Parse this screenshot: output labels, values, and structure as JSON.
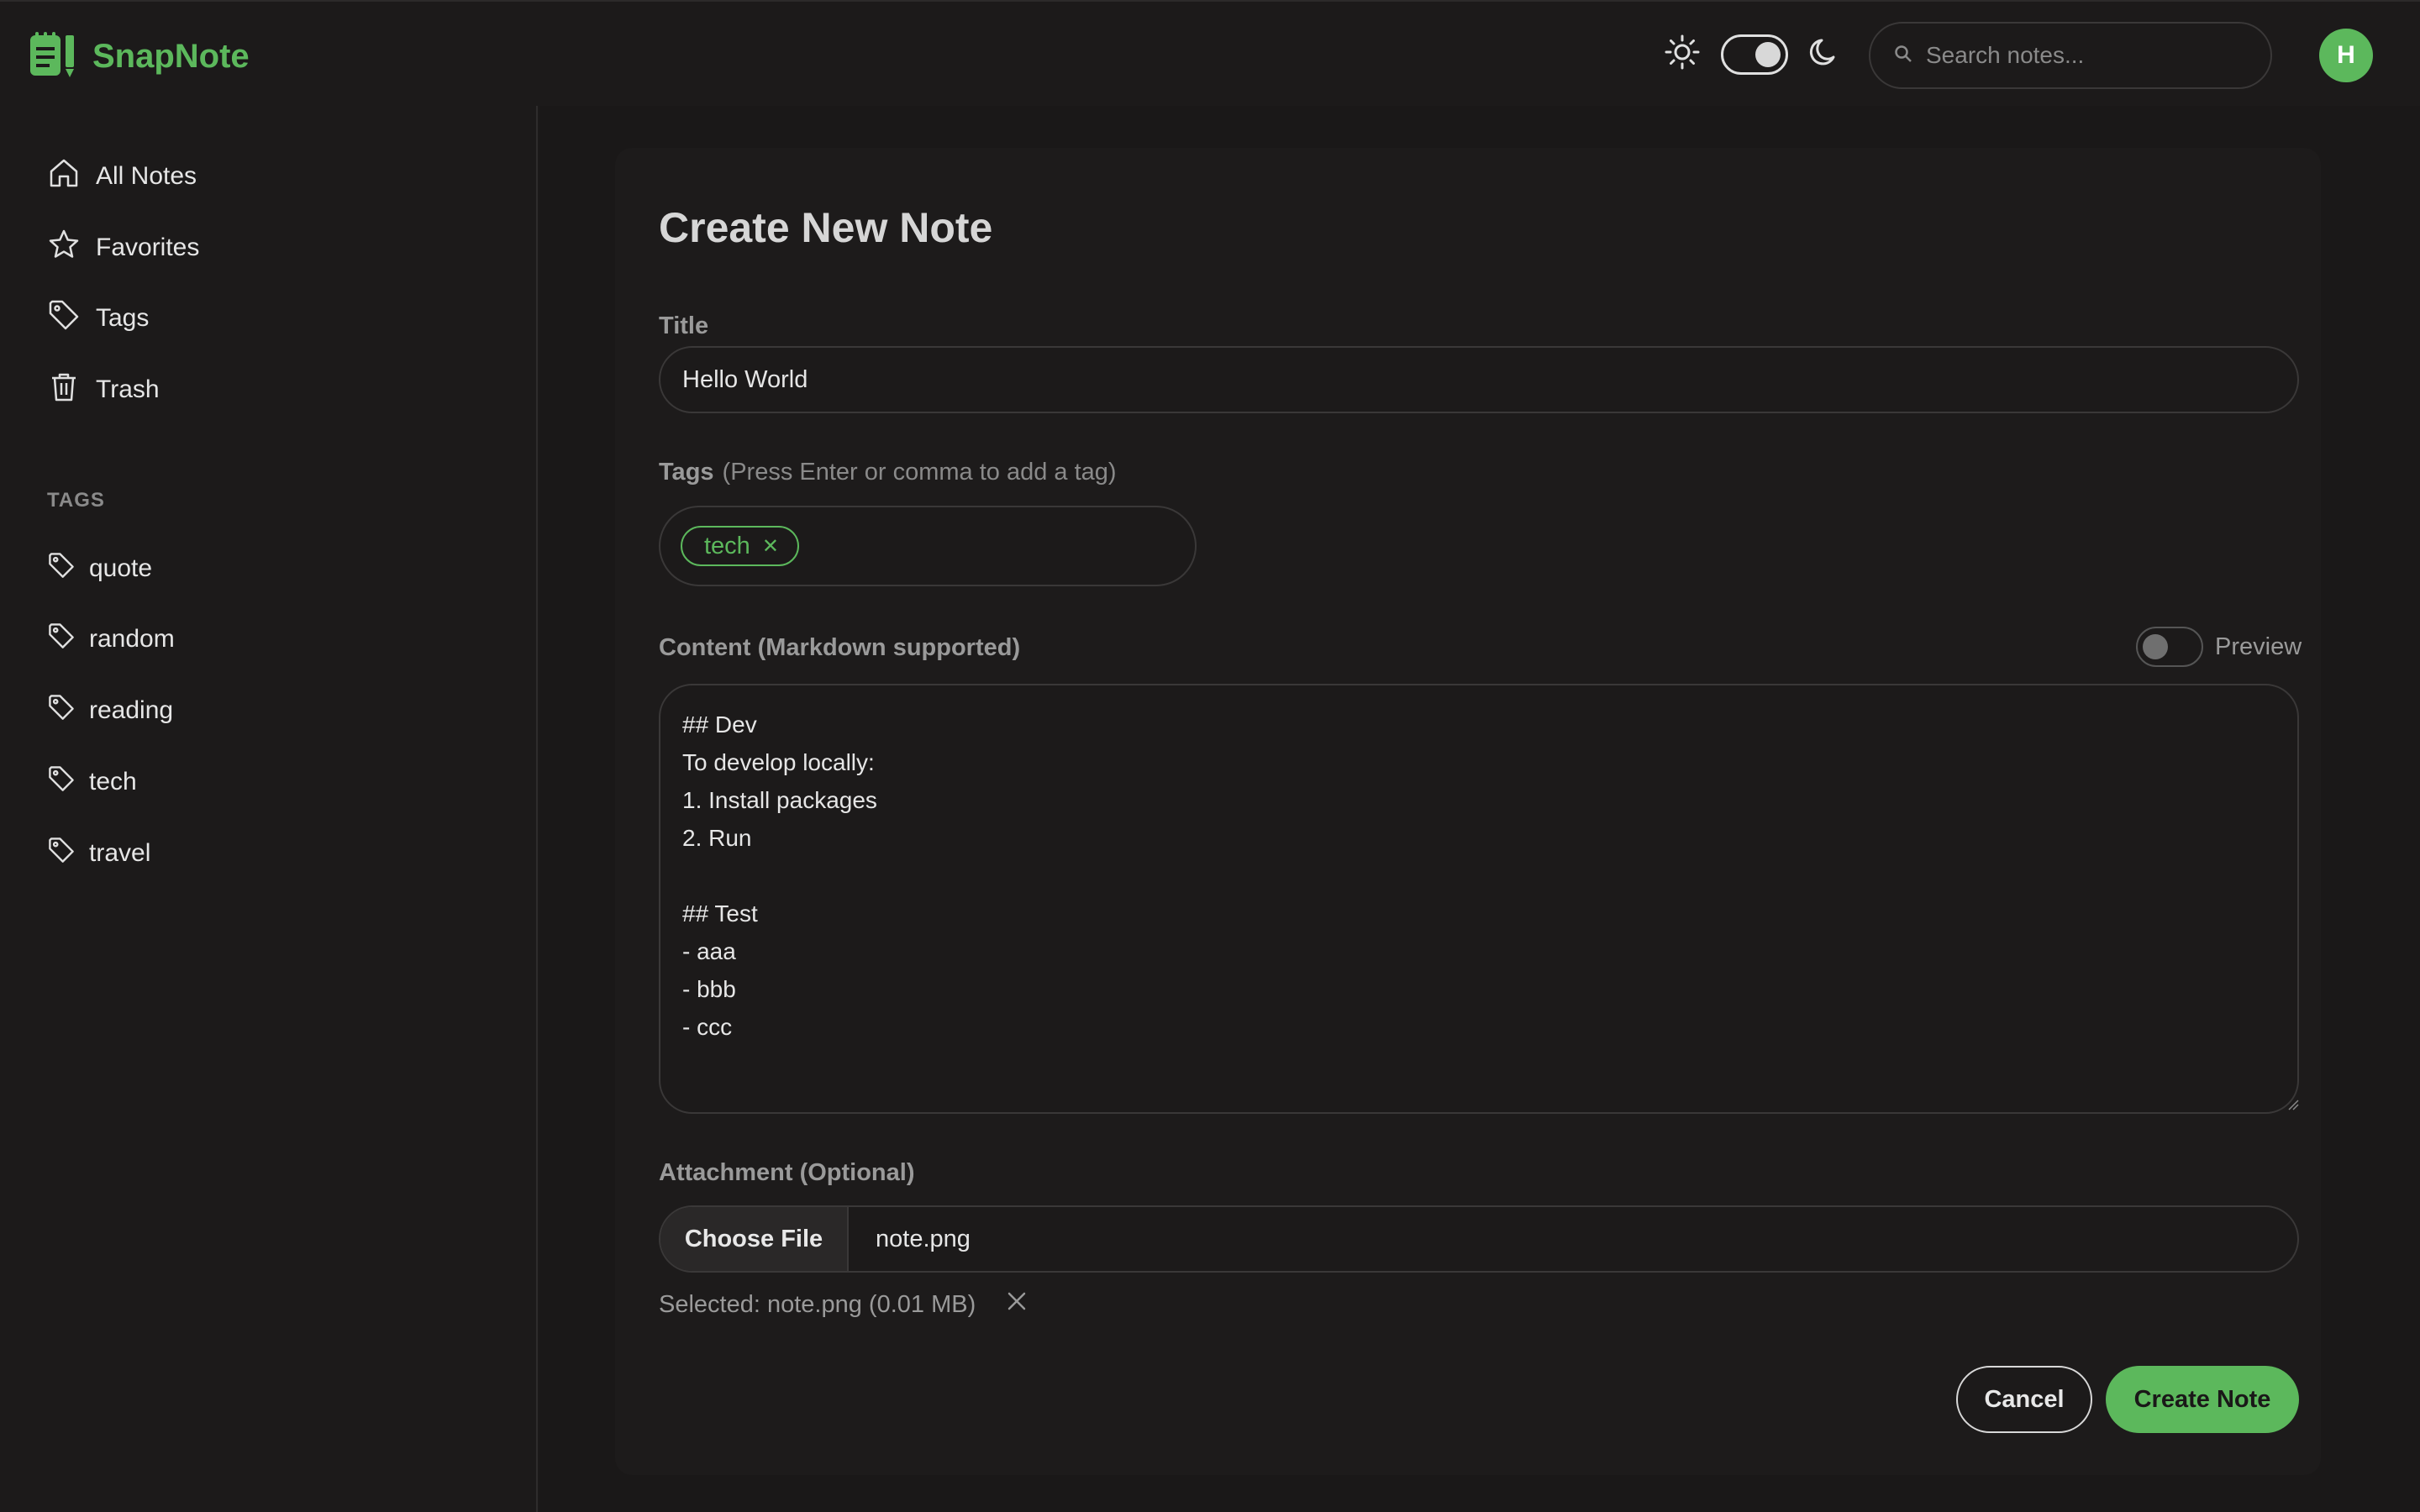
{
  "app": {
    "name": "SnapNote"
  },
  "colors": {
    "accent": "#5cb85c",
    "background": "#1c1a1a"
  },
  "header": {
    "search_placeholder": "Search notes...",
    "avatar_initial": "H",
    "theme_mode": "dark"
  },
  "sidebar": {
    "items": [
      {
        "label": "All Notes",
        "icon": "home-icon"
      },
      {
        "label": "Favorites",
        "icon": "star-icon"
      },
      {
        "label": "Tags",
        "icon": "tag-icon"
      },
      {
        "label": "Trash",
        "icon": "trash-icon"
      }
    ],
    "tags_title": "TAGS",
    "tags": [
      "quote",
      "random",
      "reading",
      "tech",
      "travel"
    ]
  },
  "form": {
    "page_title": "Create New Note",
    "title_label": "Title",
    "title_value": "Hello World",
    "tags_label": "Tags",
    "tags_hint": "(Press Enter or comma to add a tag)",
    "tags": [
      "tech"
    ],
    "content_label": "Content (Markdown supported)",
    "preview_label": "Preview",
    "content_value": "## Dev\nTo develop locally:\n1. Install packages\n2. Run\n\n## Test\n- aaa\n- bbb\n- ccc",
    "attachment_label": "Attachment (Optional)",
    "choose_file_label": "Choose File",
    "file_name": "note.png",
    "selected_text": "Selected: note.png (0.01 MB)",
    "cancel_label": "Cancel",
    "submit_label": "Create Note"
  }
}
